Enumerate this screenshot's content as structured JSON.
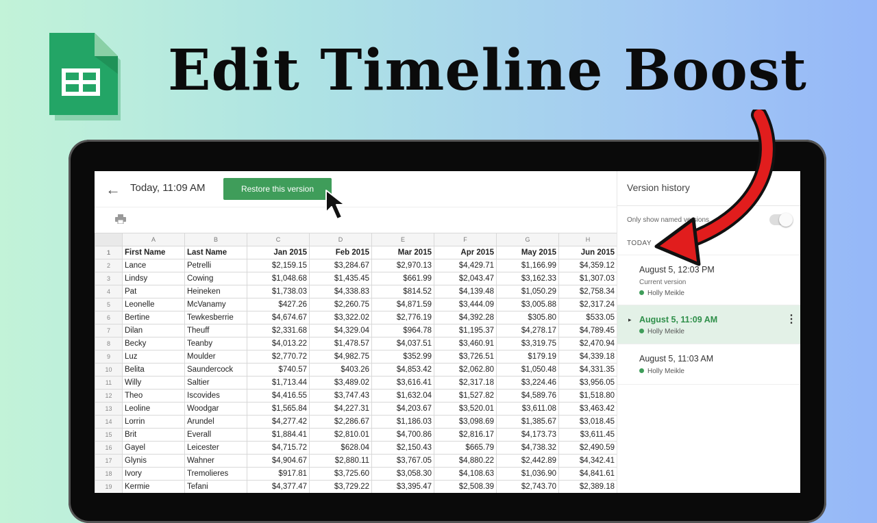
{
  "headline": "Edit Timeline Boost",
  "colors": {
    "sheets_green": "#23a566",
    "restore_button": "#3f9d5a",
    "selected_row": "#e3f1e7",
    "arrow_red": "#e11d1d"
  },
  "topbar": {
    "back_icon": "←",
    "version_time": "Today, 11:09 AM",
    "restore_label": "Restore this version"
  },
  "sheet": {
    "column_letters": [
      "A",
      "B",
      "C",
      "D",
      "E",
      "F",
      "G",
      "H"
    ],
    "headers": [
      "First Name",
      "Last Name",
      "Jan 2015",
      "Feb 2015",
      "Mar 2015",
      "Apr 2015",
      "May 2015",
      "Jun 2015"
    ],
    "rows": [
      [
        "Lance",
        "Petrelli",
        "$2,159.15",
        "$3,284.67",
        "$2,970.13",
        "$4,429.71",
        "$1,166.99",
        "$4,359.12"
      ],
      [
        "Lindsy",
        "Cowing",
        "$1,048.68",
        "$1,435.45",
        "$661.99",
        "$2,043.47",
        "$3,162.33",
        "$1,307.03"
      ],
      [
        "Pat",
        "Heineken",
        "$1,738.03",
        "$4,338.83",
        "$814.52",
        "$4,139.48",
        "$1,050.29",
        "$2,758.34"
      ],
      [
        "Leonelle",
        "McVanamy",
        "$427.26",
        "$2,260.75",
        "$4,871.59",
        "$3,444.09",
        "$3,005.88",
        "$2,317.24"
      ],
      [
        "Bertine",
        "Tewkesberrie",
        "$4,674.67",
        "$3,322.02",
        "$2,776.19",
        "$4,392.28",
        "$305.80",
        "$533.05"
      ],
      [
        "Dilan",
        "Theuff",
        "$2,331.68",
        "$4,329.04",
        "$964.78",
        "$1,195.37",
        "$4,278.17",
        "$4,789.45"
      ],
      [
        "Becky",
        "Teanby",
        "$4,013.22",
        "$1,478.57",
        "$4,037.51",
        "$3,460.91",
        "$3,319.75",
        "$2,470.94"
      ],
      [
        "Luz",
        "Moulder",
        "$2,770.72",
        "$4,982.75",
        "$352.99",
        "$3,726.51",
        "$179.19",
        "$4,339.18"
      ],
      [
        "Belita",
        "Saundercock",
        "$740.57",
        "$403.26",
        "$4,853.42",
        "$2,062.80",
        "$1,050.48",
        "$4,331.35"
      ],
      [
        "Willy",
        "Saltier",
        "$1,713.44",
        "$3,489.02",
        "$3,616.41",
        "$2,317.18",
        "$3,224.46",
        "$3,956.05"
      ],
      [
        "Theo",
        "Iscovides",
        "$4,416.55",
        "$3,747.43",
        "$1,632.04",
        "$1,527.82",
        "$4,589.76",
        "$1,518.80"
      ],
      [
        "Leoline",
        "Woodgar",
        "$1,565.84",
        "$4,227.31",
        "$4,203.67",
        "$3,520.01",
        "$3,611.08",
        "$3,463.42"
      ],
      [
        "Lorrin",
        "Arundel",
        "$4,277.42",
        "$2,286.67",
        "$1,186.03",
        "$3,098.69",
        "$1,385.67",
        "$3,018.45"
      ],
      [
        "Brit",
        "Everall",
        "$1,884.41",
        "$2,810.01",
        "$4,700.86",
        "$2,816.17",
        "$4,173.73",
        "$3,611.45"
      ],
      [
        "Gayel",
        "Leicester",
        "$4,715.72",
        "$628.04",
        "$2,150.43",
        "$665.79",
        "$4,738.32",
        "$2,490.59"
      ],
      [
        "Glynis",
        "Wahner",
        "$4,904.67",
        "$2,880.11",
        "$3,767.05",
        "$4,880.22",
        "$2,442.89",
        "$4,342.41"
      ],
      [
        "Ivory",
        "Tremolieres",
        "$917.81",
        "$3,725.60",
        "$3,058.30",
        "$4,108.63",
        "$1,036.90",
        "$4,841.61"
      ],
      [
        "Kermie",
        "Tefani",
        "$4,377.47",
        "$3,729.22",
        "$3,395.47",
        "$2,508.39",
        "$2,743.70",
        "$2,389.18"
      ]
    ]
  },
  "panel": {
    "title": "Version history",
    "named_toggle_label": "Only show named versions",
    "section_label": "TODAY",
    "versions": [
      {
        "date": "August 5, 12:03 PM",
        "sub": "Current version",
        "author": "Holly Meikle"
      },
      {
        "date": "August 5, 11:09 AM",
        "author": "Holly Meikle",
        "more_icon": "⋮",
        "expand_icon": "▸"
      },
      {
        "date": "August 5, 11:03 AM",
        "author": "Holly Meikle"
      }
    ]
  }
}
